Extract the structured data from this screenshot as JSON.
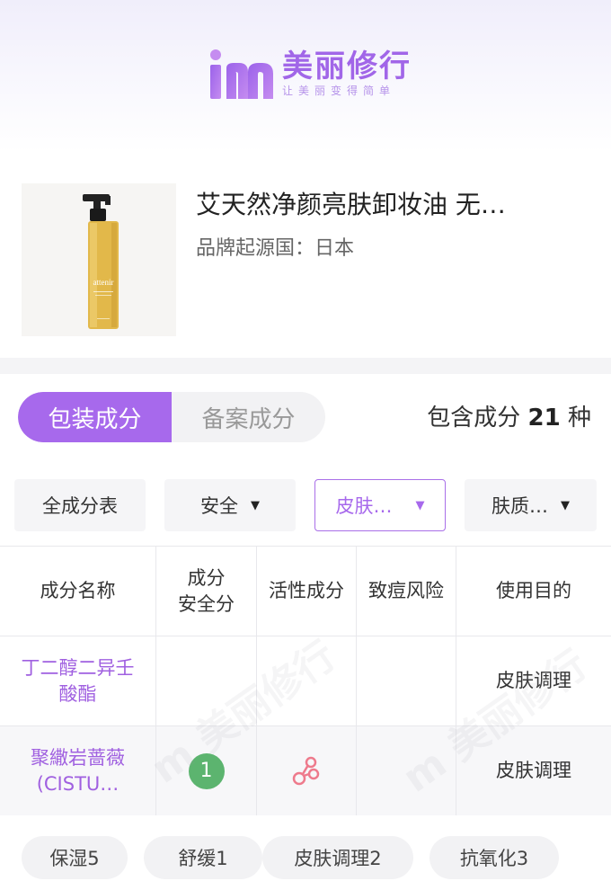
{
  "brand": {
    "name": "美丽修行",
    "slogan": "让美丽变得简单",
    "logo_letter": "m",
    "accent_color": "#a769ec"
  },
  "product": {
    "title": "艾天然净颜亮肤卸妆油 无…",
    "origin_label": "品牌起源国：",
    "origin_value": "日本",
    "image_alt": "attenir"
  },
  "tabs": [
    {
      "label": "包装成分",
      "active": true
    },
    {
      "label": "备案成分",
      "active": false
    }
  ],
  "ingredient_count": {
    "prefix": "包含成分",
    "number": "21",
    "suffix": "种"
  },
  "filters": [
    {
      "label": "全成分表",
      "dropdown": false,
      "active": false
    },
    {
      "label": "安全",
      "dropdown": true,
      "active": false
    },
    {
      "label": "皮肤…",
      "dropdown": true,
      "active": true
    },
    {
      "label": "肤质…",
      "dropdown": true,
      "active": false
    }
  ],
  "table": {
    "headers": [
      "成分名称",
      "成分\n安全分",
      "活性成分",
      "致痘风险",
      "使用目的"
    ],
    "rows": [
      {
        "name": "丁二醇二异壬酸酯",
        "score": "",
        "active": false,
        "acne": "",
        "purpose": "皮肤调理"
      },
      {
        "name": "聚繖岩蔷薇(CISTU…",
        "score": "1",
        "active": true,
        "acne": "",
        "purpose": "皮肤调理"
      }
    ]
  },
  "watermark_text": "m 美丽修行",
  "bottom_tags": [
    {
      "label": "保湿5"
    },
    {
      "label": "舒缓1"
    },
    {
      "label": "皮肤调理2"
    },
    {
      "label": "抗氧化3"
    }
  ]
}
